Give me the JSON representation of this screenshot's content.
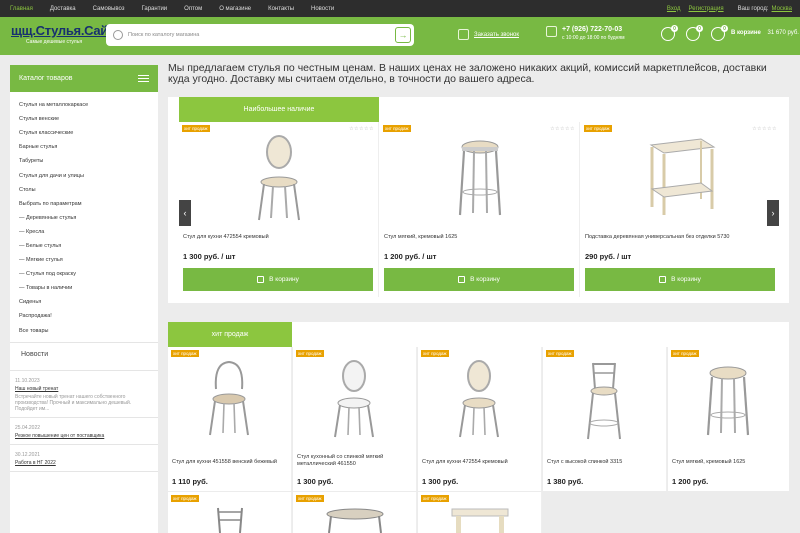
{
  "topbar": {
    "nav": [
      "Главная",
      "Доставка",
      "Самовывоз",
      "Гарантии",
      "Оптом",
      "О магазине",
      "Контакты",
      "Новости"
    ],
    "login": "Вход",
    "register": "Регистрация",
    "city_label": "Ваш город:",
    "city": "Москва"
  },
  "header": {
    "logo": "щщ.Стулья.Сайт",
    "slogan": "Самые дешевые стулья",
    "search_placeholder": "Поиск по каталогу магазина",
    "callback": "Заказать звонок",
    "phone": "+7 (926) 722-70-03",
    "hours": "с 10:00 до 18:00 по будням",
    "icon_counts": [
      "0",
      "0",
      "0"
    ],
    "cart_label": "В корзине",
    "cart_sum": "31 670 руб."
  },
  "sidebar": {
    "catalog_title": "Каталог товаров",
    "categories": [
      "Стулья на металлокаркасе",
      "Стулья венские",
      "Стулья классические",
      "Барные стулья",
      "Табуреты",
      "Стулья для дачи и улицы",
      "Столы",
      "Выбрать по параметрам",
      "—   Деревянные стулья",
      "—   Кресла",
      "—   Белые стулья",
      "—   Мягкие стулья",
      "—   Стулья под окраску",
      "—   Товары в наличии",
      "Сиденья",
      "Распродажа!",
      "Все товары"
    ],
    "news_title": "Новости",
    "news": [
      {
        "date": "11.10.2023",
        "title": "Наш новый тренат",
        "desc": "Встречайте новый тренат нашего собственного производства! Прочный и максимально дешевый. Подойдет им..."
      },
      {
        "date": "25.04.2022",
        "title": "Резкое повышение цен от поставщика",
        "desc": ""
      },
      {
        "date": "30.12.2021",
        "title": "Работа в НГ 2022",
        "desc": ""
      }
    ]
  },
  "intro": "Мы предлагаем стулья по честным ценам. В наших ценах не заложено никаких акций, комиссий маркетплейсов, доставки куда угодно. Доставку мы считаем отдельно, в точности до вашего адреса.",
  "section1": {
    "tab": "Наибольшее наличие",
    "products": [
      {
        "badge": "хит продаж",
        "name": "Стул для кухни 472554 кремовый",
        "price": "1 300 руб. / шт",
        "button": "В корзину"
      },
      {
        "badge": "хит продаж",
        "name": "Стул мягкий, кремовый 1625",
        "price": "1 200 руб. / шт",
        "button": "В корзину"
      },
      {
        "badge": "хит продаж",
        "name": "Подставка деревянная универсальная без отделки 5730",
        "price": "290 руб. / шт",
        "button": "В корзину"
      }
    ]
  },
  "section2": {
    "tab": "хит продаж",
    "products": [
      {
        "badge": "хит продаж",
        "name": "Стул для кухни 451558 венский бежевый",
        "price": "1 110 руб."
      },
      {
        "badge": "хит продаж",
        "name": "Стул кухонный со спинкой мягкий металлический 461550",
        "price": "1 300 руб."
      },
      {
        "badge": "хит продаж",
        "name": "Стул для кухни 472554 кремовый",
        "price": "1 300 руб."
      },
      {
        "badge": "хит продаж",
        "name": "Стул с высокой спинкой 3315",
        "price": "1 380 руб."
      },
      {
        "badge": "хит продаж",
        "name": "Стул мягкий, кремовый 1625",
        "price": "1 200 руб."
      },
      {
        "badge": "хит продаж",
        "name": "",
        "price": ""
      },
      {
        "badge": "хит продаж",
        "name": "",
        "price": ""
      },
      {
        "badge": "хит продаж",
        "name": "",
        "price": ""
      }
    ]
  },
  "stars": "☆☆☆☆☆",
  "colors": {
    "accent": "#78b943",
    "topbar": "#2d2d2d",
    "badge": "#e8a100"
  }
}
